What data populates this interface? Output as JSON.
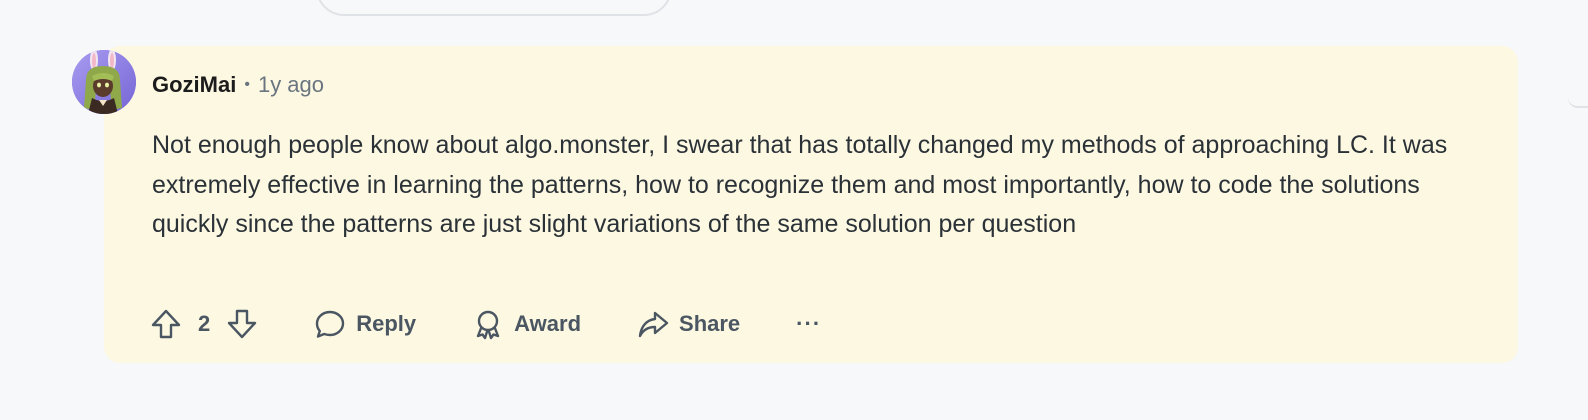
{
  "comment": {
    "username": "GoziMai",
    "separator": "•",
    "timestamp": "1y ago",
    "body": "Not enough people know about algo.monster, I swear that has totally changed my methods of approaching LC. It was extremely effective in learning the patterns, how to recognize them and most importantly, how to code the solutions quickly since the patterns are just slight variations of the same solution per question",
    "avatar_icon": "anime-avatar-icon",
    "card_color": "#fdf8e2"
  },
  "actions": {
    "upvote_icon": "upvote-arrow-icon",
    "vote_count": "2",
    "downvote_icon": "downvote-arrow-icon",
    "reply_label": "Reply",
    "award_label": "Award",
    "share_label": "Share",
    "more_label": "···"
  }
}
